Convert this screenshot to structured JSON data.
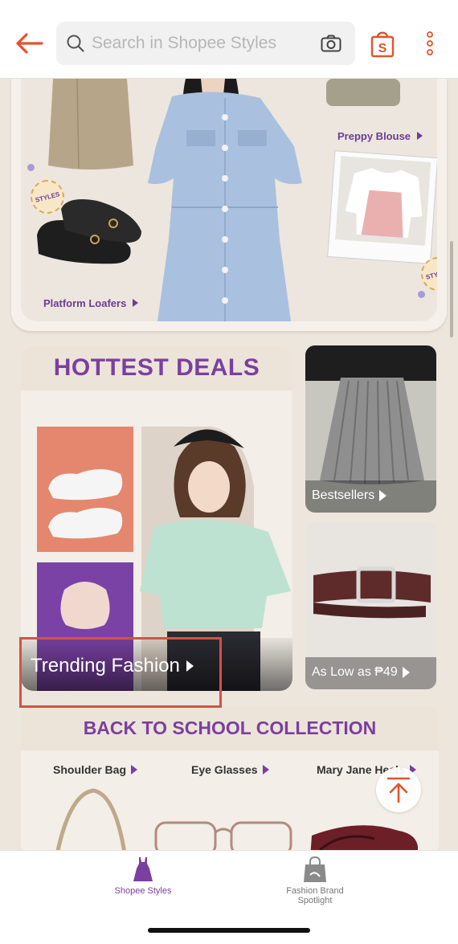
{
  "header": {
    "search_placeholder": "Search in Shopee Styles"
  },
  "hero": {
    "labels": {
      "preppy_blouse": "Preppy Blouse",
      "platform_loafers": "Platform Loafers"
    },
    "badge_text": "STYLES"
  },
  "hottest_deals": {
    "title": "HOTTEST DEALS",
    "trending": "Trending Fashion"
  },
  "side_tiles": {
    "bestsellers": "Bestsellers",
    "low_price": "As Low as ₱49"
  },
  "back_to_school": {
    "title": "BACK TO SCHOOL COLLECTION",
    "items": [
      "Shoulder Bag",
      "Eye Glasses",
      "Mary Jane Heels"
    ]
  },
  "bottom_nav": {
    "items": [
      {
        "label": "Shopee Styles"
      },
      {
        "label": "Fashion Brand Spotlight"
      }
    ]
  },
  "colors": {
    "accent": "#e2532d",
    "brand_purple": "#7b3fa0",
    "highlight_box": "#d45148"
  }
}
